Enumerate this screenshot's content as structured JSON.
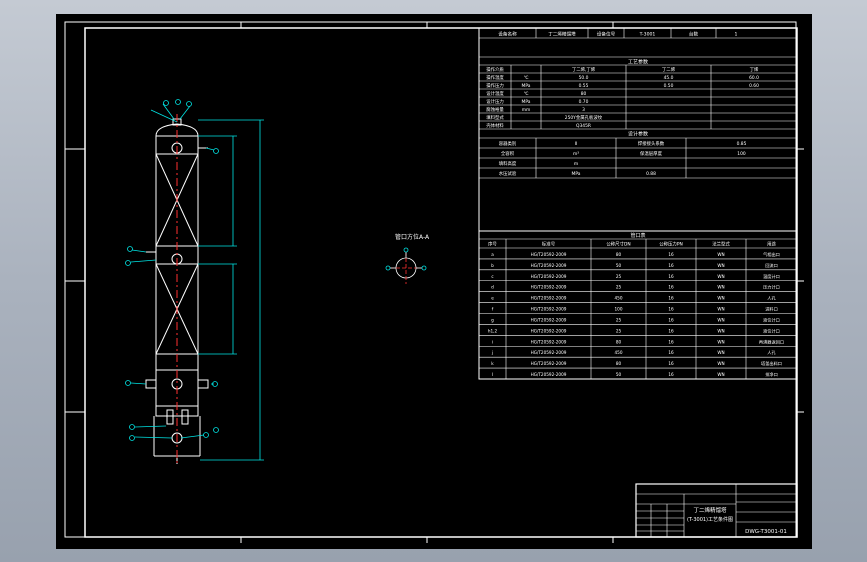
{
  "colors": {
    "background": "#000000",
    "frame": "#ffffff",
    "vessel": "#ffffff",
    "centerline": "#ff3030",
    "dimension": "#00e5e5"
  },
  "section_label": "管口方位A-A",
  "title_block": {
    "drawing_title_line1": "丁二烯精馏塔",
    "drawing_title_line2": "(T-3001)工艺条件图",
    "drawing_no": "DWG-T3001-01"
  },
  "general_table": {
    "header": [
      "设备名称",
      "丁二烯精馏塔",
      "设备位号",
      "T-3001",
      "台数",
      "1"
    ],
    "process_title": "工艺参数",
    "rows": [
      [
        "操作介质",
        "",
        "丁二烯,丁烯",
        "丁二烯",
        "丁烯"
      ],
      [
        "操作温度",
        "℃",
        "50.0",
        "45.0",
        "60.0"
      ],
      [
        "操作压力",
        "MPa",
        "0.55",
        "0.50",
        "0.60"
      ],
      [
        "设计温度",
        "℃",
        "80",
        "",
        ""
      ],
      [
        "设计压力",
        "MPa",
        "0.70",
        "",
        ""
      ],
      [
        "腐蚀裕量",
        "mm",
        "3",
        "",
        ""
      ],
      [
        "填料型式",
        "",
        "250Y金属孔板波纹",
        "",
        ""
      ],
      [
        "壳体材料",
        "",
        "Q345R",
        "",
        ""
      ]
    ],
    "spec_title": "设计参数",
    "spec_rows": [
      [
        "容器类别",
        "Ⅱ",
        "焊接接头系数",
        "0.85"
      ],
      [
        "全容积",
        "m³",
        "保温层厚度",
        "100"
      ],
      [
        "填料高度",
        "m",
        "",
        ""
      ],
      [
        "水压试验",
        "MPa",
        "0.88",
        ""
      ]
    ]
  },
  "nozzle_table": {
    "title": "管口表",
    "columns": [
      "序号",
      "标准号",
      "公称尺寸DN",
      "公称压力PN",
      "法兰型式",
      "用途"
    ],
    "rows": [
      [
        "a",
        "HG/T20592-2009",
        "80",
        "16",
        "WN",
        "气相出口"
      ],
      [
        "b",
        "HG/T20592-2009",
        "50",
        "16",
        "WN",
        "回流口"
      ],
      [
        "c",
        "HG/T20592-2009",
        "25",
        "16",
        "WN",
        "温度计口"
      ],
      [
        "d",
        "HG/T20592-2009",
        "25",
        "16",
        "WN",
        "压力计口"
      ],
      [
        "e",
        "HG/T20592-2009",
        "450",
        "16",
        "WN",
        "人孔"
      ],
      [
        "f",
        "HG/T20592-2009",
        "100",
        "16",
        "WN",
        "进料口"
      ],
      [
        "g",
        "HG/T20592-2009",
        "25",
        "16",
        "WN",
        "液位计口"
      ],
      [
        "h1,2",
        "HG/T20592-2009",
        "25",
        "16",
        "WN",
        "液位计口"
      ],
      [
        "i",
        "HG/T20592-2009",
        "80",
        "16",
        "WN",
        "再沸器返回口"
      ],
      [
        "j",
        "HG/T20592-2009",
        "450",
        "16",
        "WN",
        "人孔"
      ],
      [
        "k",
        "HG/T20592-2009",
        "80",
        "16",
        "WN",
        "塔釜出料口"
      ],
      [
        "l",
        "HG/T20592-2009",
        "50",
        "16",
        "WN",
        "排净口"
      ]
    ]
  }
}
